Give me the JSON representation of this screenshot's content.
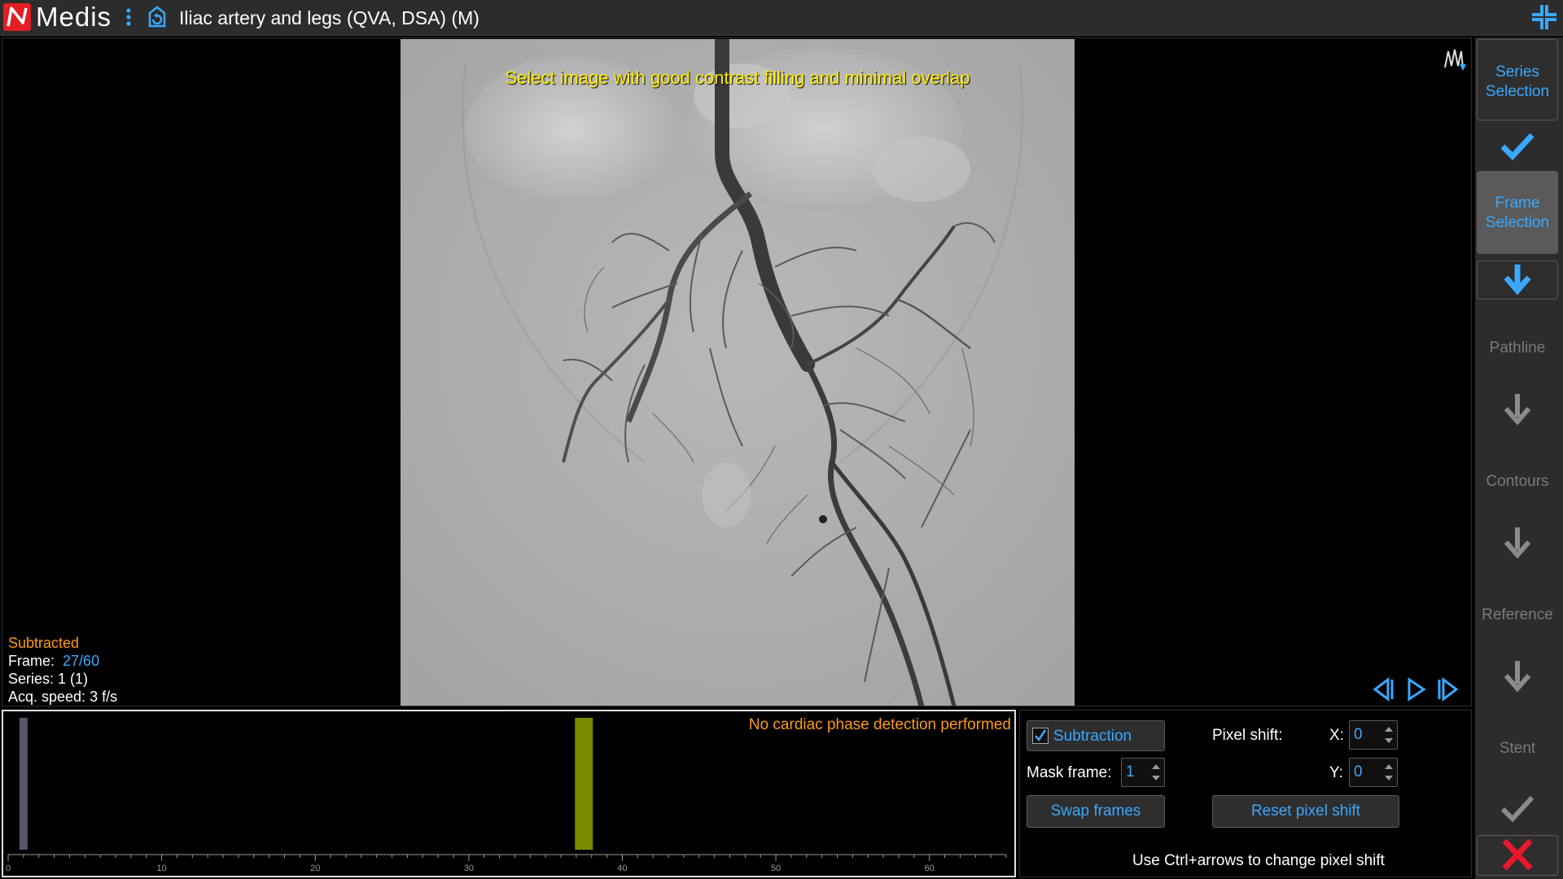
{
  "app": {
    "logo_text": "Medis",
    "title": "Iliac artery and legs (QVA, DSA) (M)"
  },
  "viewer": {
    "instruction": "Select image with good contrast filling and minimal overlap",
    "mode": "Subtracted",
    "frame_label": "Frame:",
    "frame_value": "27/60",
    "series": "Series: 1 (1)",
    "acq_speed": "Acq. speed: 3 f/s"
  },
  "timeline": {
    "message": "No cardiac phase detection performed",
    "frames_total": 60,
    "axis_max": 65,
    "tick_labels": [
      "0",
      "10",
      "20",
      "30",
      "40",
      "50",
      "60"
    ],
    "mask_frame": 1,
    "selected_frame": 37.5,
    "colors": {
      "mask_marker": "#55556a",
      "selected_marker": "#7a8a00",
      "axis": "#9a9a9a"
    }
  },
  "controls": {
    "subtraction_label": "Subtraction",
    "subtraction_checked": true,
    "mask_frame_label": "Mask frame:",
    "mask_frame_value": "1",
    "pixel_shift_label": "Pixel shift:",
    "x_label": "X:",
    "x_value": "0",
    "y_label": "Y:",
    "y_value": "0",
    "swap_frames_label": "Swap frames",
    "reset_pixel_shift_label": "Reset pixel shift",
    "hint": "Use Ctrl+arrows to change pixel shift"
  },
  "workflow": {
    "series_selection": "Series Selection",
    "frame_selection": "Frame Selection",
    "pathline": "Pathline",
    "contours": "Contours",
    "reference": "Reference",
    "stent": "Stent"
  },
  "colors": {
    "accent_blue": "#3aa8ff",
    "warning_orange": "#ff9a1a",
    "instruction_yellow": "#ffee00",
    "cancel_red": "#e8182c"
  }
}
